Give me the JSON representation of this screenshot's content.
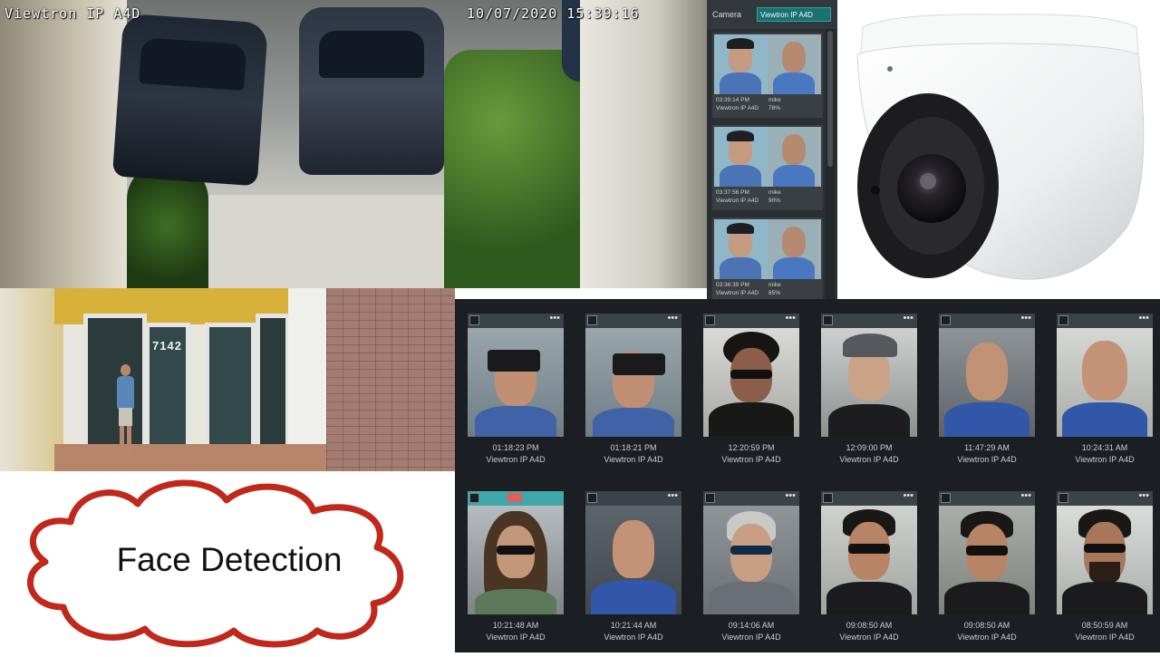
{
  "main_feed": {
    "camera_name": "Viewtron IP A4D",
    "timestamp": "10/07/2020 15:39:16"
  },
  "face_panel": {
    "camera_label": "Camera",
    "selected_camera": "Viewtron IP A4D",
    "matches": [
      {
        "time": "03:39:14 PM",
        "camera": "Viewtron IP A4D",
        "name": "mike",
        "similarity": "78%"
      },
      {
        "time": "03:37:56 PM",
        "camera": "Viewtron IP A4D",
        "name": "mike",
        "similarity": "90%"
      },
      {
        "time": "03:36:39 PM",
        "camera": "Viewtron IP A4D",
        "name": "mike",
        "similarity": "85%"
      }
    ]
  },
  "entrance_feed": {
    "door_number": "7142"
  },
  "gallery": {
    "rows": [
      [
        {
          "time": "01:18:23 PM",
          "camera": "Viewtron IP A4D"
        },
        {
          "time": "01:18:21 PM",
          "camera": "Viewtron IP A4D"
        },
        {
          "time": "12:20:59 PM",
          "camera": "Viewtron IP A4D"
        },
        {
          "time": "12:09:00 PM",
          "camera": "Viewtron IP A4D"
        },
        {
          "time": "11:47:29 AM",
          "camera": "Viewtron IP A4D"
        },
        {
          "time": "10:24:31 AM",
          "camera": "Viewtron IP A4D"
        }
      ],
      [
        {
          "time": "10:21:48 AM",
          "camera": "Viewtron IP A4D"
        },
        {
          "time": "10:21:44 AM",
          "camera": "Viewtron IP A4D"
        },
        {
          "time": "09:14:06 AM",
          "camera": "Viewtron IP A4D"
        },
        {
          "time": "09:08:50 AM",
          "camera": "Viewtron IP A4D"
        },
        {
          "time": "09:08:50 AM",
          "camera": "Viewtron IP A4D"
        },
        {
          "time": "08:50:59 AM",
          "camera": "Viewtron IP A4D"
        }
      ]
    ],
    "more_glyph": "•••",
    "active_card_color": "#3fa7a7"
  },
  "caption": {
    "text": "Face Detection",
    "cloud_border_color": "#c0281c"
  }
}
